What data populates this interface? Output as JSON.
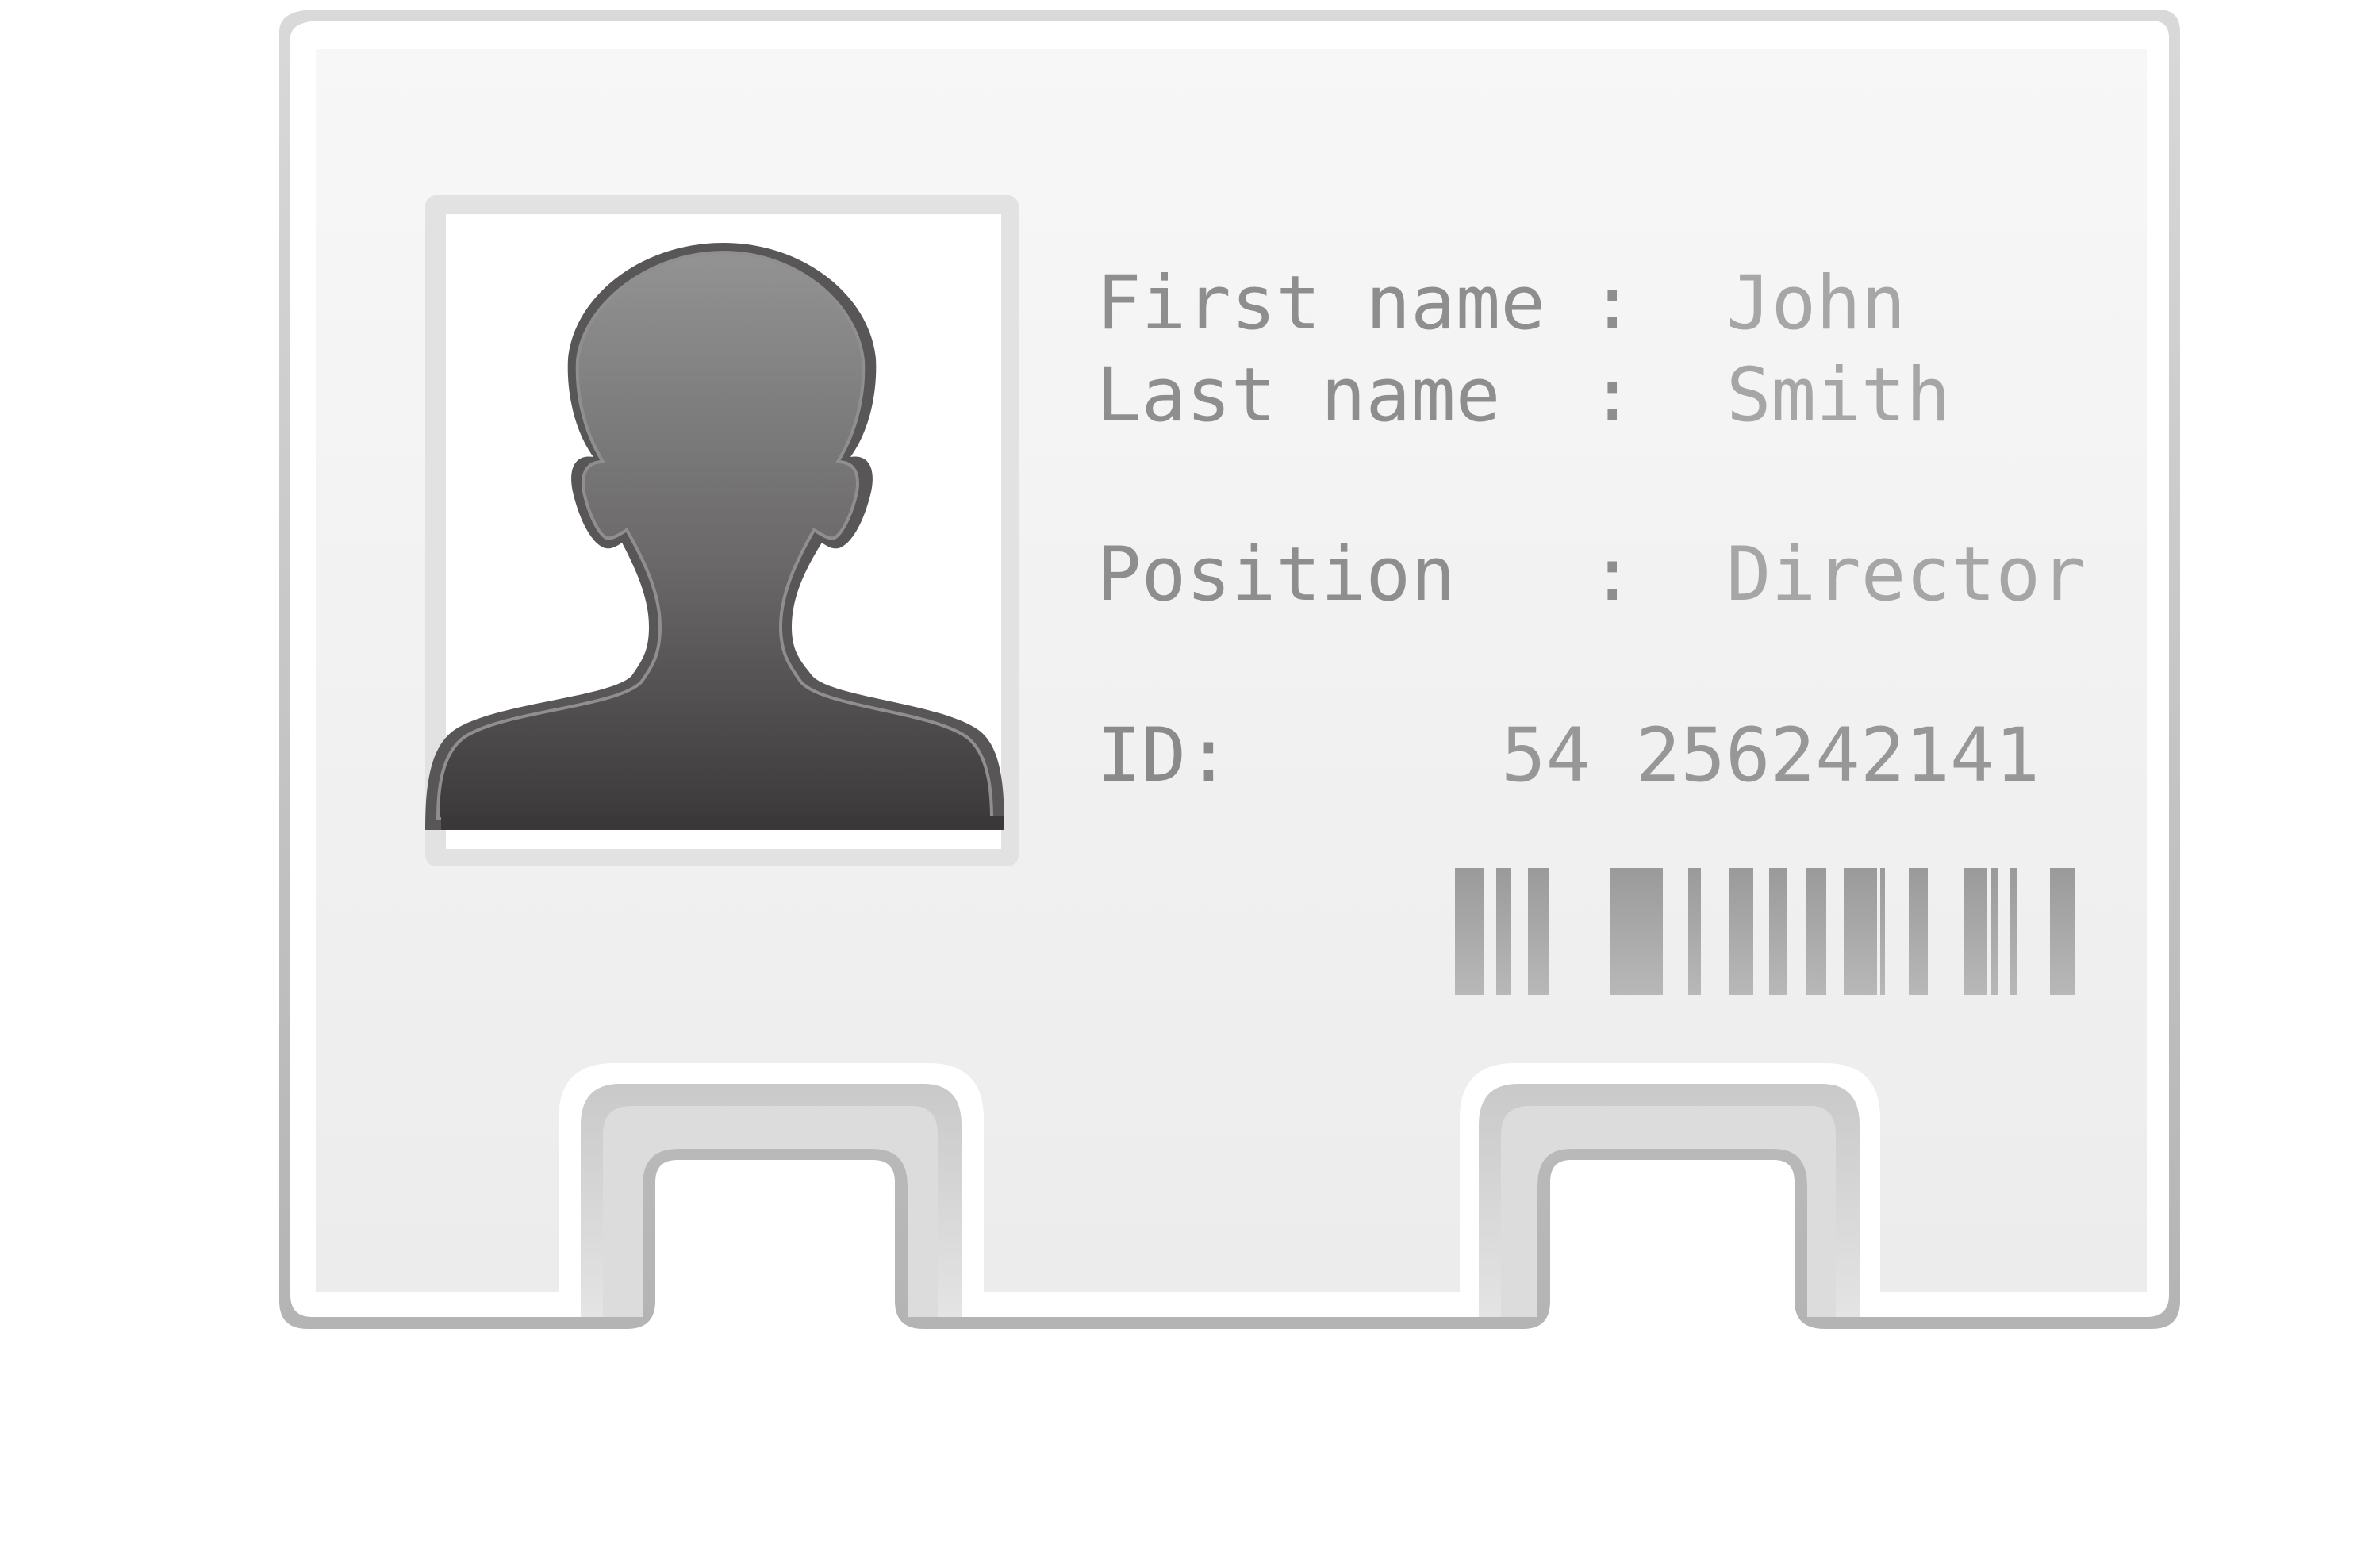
{
  "card": {
    "fields": [
      {
        "label": "First name",
        "separator": ":",
        "value": "John"
      },
      {
        "label": "Last name",
        "separator": ":",
        "value": "Smith"
      },
      {
        "label": "Position",
        "separator": ":",
        "value": "Director"
      }
    ],
    "id_label": "ID:",
    "id_value": "54 256242141",
    "icons": {
      "photo": "person-silhouette-icon",
      "barcode": "barcode-icon"
    },
    "colors": {
      "card_fill": "#f2f2f2",
      "card_border": "#bdbdbd",
      "silhouette_top": "#8e8e8e",
      "silhouette_bottom": "#3e3c3c",
      "text": "#9a9a9a"
    }
  }
}
